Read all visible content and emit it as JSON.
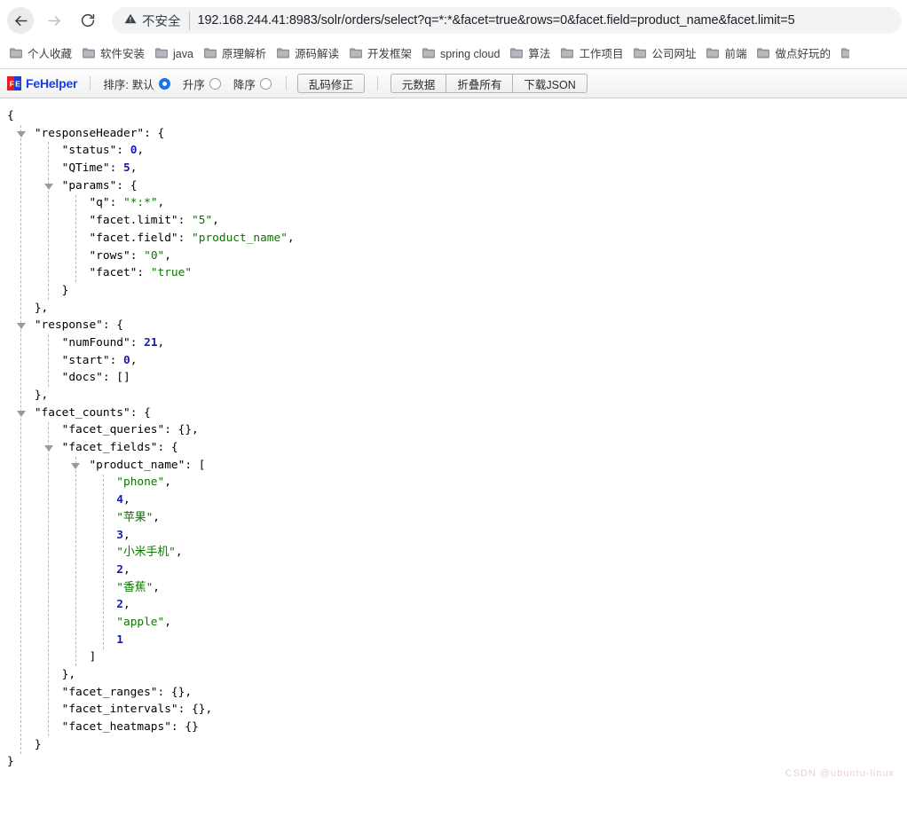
{
  "browser": {
    "nav": {
      "back_icon": "back-arrow-icon",
      "forward_icon": "forward-arrow-icon",
      "reload_icon": "reload-icon"
    },
    "omnibox": {
      "security_icon": "warning-triangle-icon",
      "security_label": "不安全",
      "url": "192.168.244.41:8983/solr/orders/select?q=*:*&facet=true&rows=0&facet.field=product_name&facet.limit=5"
    },
    "bookmarks": [
      {
        "label": "个人收藏",
        "icon": "folder-icon"
      },
      {
        "label": "软件安装",
        "icon": "folder-icon"
      },
      {
        "label": "java",
        "icon": "folder-icon"
      },
      {
        "label": "原理解析",
        "icon": "folder-icon"
      },
      {
        "label": "源码解读",
        "icon": "folder-icon"
      },
      {
        "label": "开发框架",
        "icon": "folder-icon"
      },
      {
        "label": "spring cloud",
        "icon": "folder-icon"
      },
      {
        "label": "算法",
        "icon": "folder-icon"
      },
      {
        "label": "工作项目",
        "icon": "folder-icon"
      },
      {
        "label": "公司网址",
        "icon": "folder-icon"
      },
      {
        "label": "前端",
        "icon": "folder-icon"
      },
      {
        "label": "做点好玩的",
        "icon": "folder-icon"
      }
    ]
  },
  "fehelper": {
    "brand": "FeHelper",
    "brand_mark": "fe-logo-icon",
    "brand_color": "#1a3fd8",
    "sort_label": "排序:",
    "sort_options": [
      {
        "label": "默认",
        "checked": true
      },
      {
        "label": "升序",
        "checked": false
      },
      {
        "label": "降序",
        "checked": false
      }
    ],
    "fix_button": "乱码修正",
    "actions": [
      "元数据",
      "折叠所有",
      "下载JSON"
    ]
  },
  "json": {
    "lines": [
      {
        "indent": 0,
        "tri": false,
        "parts": [
          {
            "t": "{",
            "c": "pn"
          }
        ]
      },
      {
        "indent": 1,
        "tri": true,
        "parts": [
          {
            "t": "\"responseHeader\"",
            "c": "k"
          },
          {
            "t": ": {",
            "c": "pn"
          }
        ]
      },
      {
        "indent": 2,
        "tri": false,
        "parts": [
          {
            "t": "\"status\"",
            "c": "k"
          },
          {
            "t": ": ",
            "c": "pn"
          },
          {
            "t": "0",
            "c": "num"
          },
          {
            "t": ",",
            "c": "pn"
          }
        ]
      },
      {
        "indent": 2,
        "tri": false,
        "parts": [
          {
            "t": "\"QTime\"",
            "c": "k"
          },
          {
            "t": ": ",
            "c": "pn"
          },
          {
            "t": "5",
            "c": "num"
          },
          {
            "t": ",",
            "c": "pn"
          }
        ]
      },
      {
        "indent": 2,
        "tri": true,
        "parts": [
          {
            "t": "\"params\"",
            "c": "k"
          },
          {
            "t": ": {",
            "c": "pn"
          }
        ]
      },
      {
        "indent": 3,
        "tri": false,
        "parts": [
          {
            "t": "\"q\"",
            "c": "k"
          },
          {
            "t": ": ",
            "c": "pn"
          },
          {
            "t": "\"*:*\"",
            "c": "str"
          },
          {
            "t": ",",
            "c": "pn"
          }
        ]
      },
      {
        "indent": 3,
        "tri": false,
        "parts": [
          {
            "t": "\"facet.limit\"",
            "c": "k"
          },
          {
            "t": ": ",
            "c": "pn"
          },
          {
            "t": "\"5\"",
            "c": "str"
          },
          {
            "t": ",",
            "c": "pn"
          }
        ]
      },
      {
        "indent": 3,
        "tri": false,
        "parts": [
          {
            "t": "\"facet.field\"",
            "c": "k"
          },
          {
            "t": ": ",
            "c": "pn"
          },
          {
            "t": "\"product_name\"",
            "c": "str"
          },
          {
            "t": ",",
            "c": "pn"
          }
        ]
      },
      {
        "indent": 3,
        "tri": false,
        "parts": [
          {
            "t": "\"rows\"",
            "c": "k"
          },
          {
            "t": ": ",
            "c": "pn"
          },
          {
            "t": "\"0\"",
            "c": "str"
          },
          {
            "t": ",",
            "c": "pn"
          }
        ]
      },
      {
        "indent": 3,
        "tri": false,
        "parts": [
          {
            "t": "\"facet\"",
            "c": "k"
          },
          {
            "t": ": ",
            "c": "pn"
          },
          {
            "t": "\"true\"",
            "c": "str"
          }
        ]
      },
      {
        "indent": 2,
        "tri": false,
        "parts": [
          {
            "t": "}",
            "c": "pn"
          }
        ]
      },
      {
        "indent": 1,
        "tri": false,
        "parts": [
          {
            "t": "},",
            "c": "pn"
          }
        ]
      },
      {
        "indent": 1,
        "tri": true,
        "parts": [
          {
            "t": "\"response\"",
            "c": "k"
          },
          {
            "t": ": {",
            "c": "pn"
          }
        ]
      },
      {
        "indent": 2,
        "tri": false,
        "parts": [
          {
            "t": "\"numFound\"",
            "c": "k"
          },
          {
            "t": ": ",
            "c": "pn"
          },
          {
            "t": "21",
            "c": "num"
          },
          {
            "t": ",",
            "c": "pn"
          }
        ]
      },
      {
        "indent": 2,
        "tri": false,
        "parts": [
          {
            "t": "\"start\"",
            "c": "k"
          },
          {
            "t": ": ",
            "c": "pn"
          },
          {
            "t": "0",
            "c": "num"
          },
          {
            "t": ",",
            "c": "pn"
          }
        ]
      },
      {
        "indent": 2,
        "tri": false,
        "parts": [
          {
            "t": "\"docs\"",
            "c": "k"
          },
          {
            "t": ": []",
            "c": "pn"
          }
        ]
      },
      {
        "indent": 1,
        "tri": false,
        "parts": [
          {
            "t": "},",
            "c": "pn"
          }
        ]
      },
      {
        "indent": 1,
        "tri": true,
        "parts": [
          {
            "t": "\"facet_counts\"",
            "c": "k"
          },
          {
            "t": ": {",
            "c": "pn"
          }
        ]
      },
      {
        "indent": 2,
        "tri": false,
        "parts": [
          {
            "t": "\"facet_queries\"",
            "c": "k"
          },
          {
            "t": ": {},",
            "c": "pn"
          }
        ]
      },
      {
        "indent": 2,
        "tri": true,
        "parts": [
          {
            "t": "\"facet_fields\"",
            "c": "k"
          },
          {
            "t": ": {",
            "c": "pn"
          }
        ]
      },
      {
        "indent": 3,
        "tri": true,
        "parts": [
          {
            "t": "\"product_name\"",
            "c": "k"
          },
          {
            "t": ": [",
            "c": "pn"
          }
        ]
      },
      {
        "indent": 4,
        "tri": false,
        "parts": [
          {
            "t": "\"phone\"",
            "c": "str"
          },
          {
            "t": ",",
            "c": "pn"
          }
        ]
      },
      {
        "indent": 4,
        "tri": false,
        "parts": [
          {
            "t": "4",
            "c": "num"
          },
          {
            "t": ",",
            "c": "pn"
          }
        ]
      },
      {
        "indent": 4,
        "tri": false,
        "parts": [
          {
            "t": "\"苹果\"",
            "c": "str"
          },
          {
            "t": ",",
            "c": "pn"
          }
        ]
      },
      {
        "indent": 4,
        "tri": false,
        "parts": [
          {
            "t": "3",
            "c": "num"
          },
          {
            "t": ",",
            "c": "pn"
          }
        ]
      },
      {
        "indent": 4,
        "tri": false,
        "parts": [
          {
            "t": "\"小米手机\"",
            "c": "str"
          },
          {
            "t": ",",
            "c": "pn"
          }
        ]
      },
      {
        "indent": 4,
        "tri": false,
        "parts": [
          {
            "t": "2",
            "c": "num"
          },
          {
            "t": ",",
            "c": "pn"
          }
        ]
      },
      {
        "indent": 4,
        "tri": false,
        "parts": [
          {
            "t": "\"香蕉\"",
            "c": "str"
          },
          {
            "t": ",",
            "c": "pn"
          }
        ]
      },
      {
        "indent": 4,
        "tri": false,
        "parts": [
          {
            "t": "2",
            "c": "num"
          },
          {
            "t": ",",
            "c": "pn"
          }
        ]
      },
      {
        "indent": 4,
        "tri": false,
        "parts": [
          {
            "t": "\"apple\"",
            "c": "str"
          },
          {
            "t": ",",
            "c": "pn"
          }
        ]
      },
      {
        "indent": 4,
        "tri": false,
        "parts": [
          {
            "t": "1",
            "c": "num"
          }
        ]
      },
      {
        "indent": 3,
        "tri": false,
        "parts": [
          {
            "t": "]",
            "c": "pn"
          }
        ]
      },
      {
        "indent": 2,
        "tri": false,
        "parts": [
          {
            "t": "},",
            "c": "pn"
          }
        ]
      },
      {
        "indent": 2,
        "tri": false,
        "parts": [
          {
            "t": "\"facet_ranges\"",
            "c": "k"
          },
          {
            "t": ": {},",
            "c": "pn"
          }
        ]
      },
      {
        "indent": 2,
        "tri": false,
        "parts": [
          {
            "t": "\"facet_intervals\"",
            "c": "k"
          },
          {
            "t": ": {},",
            "c": "pn"
          }
        ]
      },
      {
        "indent": 2,
        "tri": false,
        "parts": [
          {
            "t": "\"facet_heatmaps\"",
            "c": "k"
          },
          {
            "t": ": {}",
            "c": "pn"
          }
        ]
      },
      {
        "indent": 1,
        "tri": false,
        "parts": [
          {
            "t": "}",
            "c": "pn"
          }
        ]
      },
      {
        "indent": 0,
        "tri": false,
        "parts": [
          {
            "t": "}",
            "c": "pn"
          }
        ]
      }
    ],
    "guides": [
      {
        "indent": 1,
        "from": 1,
        "to": 36
      },
      {
        "indent": 2,
        "from": 2,
        "to": 10
      },
      {
        "indent": 3,
        "from": 5,
        "to": 9
      },
      {
        "indent": 2,
        "from": 13,
        "to": 15
      },
      {
        "indent": 2,
        "from": 18,
        "to": 35
      },
      {
        "indent": 3,
        "from": 20,
        "to": 31
      },
      {
        "indent": 4,
        "from": 21,
        "to": 30
      }
    ]
  },
  "watermark": "CSDN @ubuntu-linux"
}
